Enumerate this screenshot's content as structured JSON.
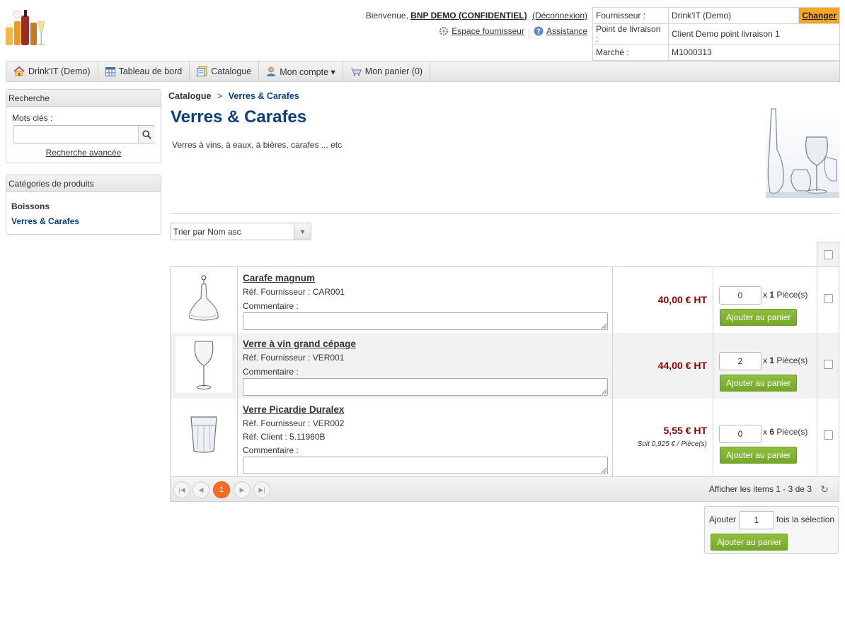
{
  "header": {
    "welcome_prefix": "Bienvenue,",
    "user": "BNP DEMO (CONFIDENTIEL)",
    "logout": "(Déconnexion)",
    "supplier_space": "Espace fournisseur",
    "assistance": "Assistance",
    "info": {
      "supplier_label": "Fournisseur :",
      "supplier_value": "Drink'IT (Demo)",
      "change": "Changer",
      "delivery_label": "Point de livraison :",
      "delivery_value": "Client Demo point livraison 1",
      "market_label": "Marché :",
      "market_value": "M1000313"
    }
  },
  "nav": {
    "home": "Drink'IT (Demo)",
    "dashboard": "Tableau de bord",
    "catalog": "Catalogue",
    "account": "Mon compte ▾",
    "cart": "Mon panier (0)"
  },
  "sidebar": {
    "search_title": "Recherche",
    "keywords_label": "Mots clés :",
    "keywords_value": "",
    "advanced": "Recherche avancée",
    "categories_title": "Catégories de produits",
    "categories": [
      "Boissons",
      "Verres & Carafes"
    ]
  },
  "main": {
    "breadcrumb_root": "Catalogue",
    "breadcrumb_sep": ">",
    "breadcrumb_current": "Verres & Carafes",
    "title": "Verres & Carafes",
    "description": "Verres à vins, à eaux, à bières, carafes ... etc",
    "sort_label": "Trier par Nom asc"
  },
  "products": [
    {
      "name": "Carafe magnum",
      "ref_supplier": "Réf. Fournisseur : CAR001",
      "ref_client": "",
      "comment_label": "Commentaire :",
      "price": "40,00 € HT",
      "unit_price": "",
      "qty": "0",
      "unit_x": "x",
      "unit_n": "1",
      "unit_label": "Pièce(s)",
      "add": "Ajouter au panier"
    },
    {
      "name": "Verre à vin grand cépage",
      "ref_supplier": "Réf. Fournisseur : VER001",
      "ref_client": "",
      "comment_label": "Commentaire :",
      "price": "44,00 € HT",
      "unit_price": "",
      "qty": "2",
      "unit_x": "x",
      "unit_n": "1",
      "unit_label": "Pièce(s)",
      "add": "Ajouter au panier"
    },
    {
      "name": "Verre Picardie Duralex",
      "ref_supplier": "Réf. Fournisseur : VER002",
      "ref_client": "Réf. Client : 5.11960B",
      "comment_label": "Commentaire :",
      "price": "5,55 € HT",
      "unit_price": "Soit 0,925 € / Pièce(s)",
      "qty": "0",
      "unit_x": "x",
      "unit_n": "6",
      "unit_label": "Pièce(s)",
      "add": "Ajouter au panier"
    }
  ],
  "pager": {
    "current_page": "1",
    "info": "Afficher les items 1 - 3 de 3"
  },
  "bulk": {
    "prefix": "Ajouter",
    "qty": "1",
    "suffix": "fois la sélection",
    "add": "Ajouter au panier"
  },
  "colors": {
    "brand_blue": "#0b3f80",
    "price_red": "#8b0000",
    "button_green": "#7ab030",
    "change_orange": "#f5a623",
    "pager_orange": "#f36d25"
  }
}
